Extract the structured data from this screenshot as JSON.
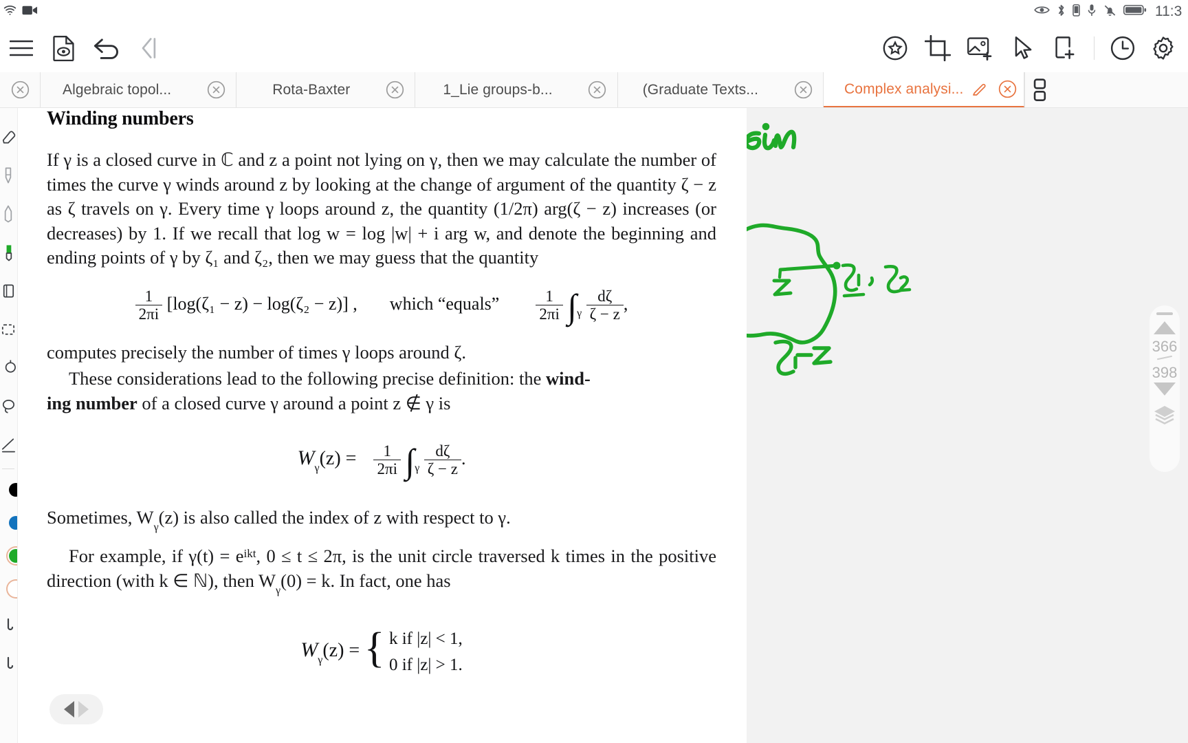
{
  "statusbar": {
    "left_icons": [
      "wifi-icon",
      "screen-record-icon"
    ],
    "right_icons": [
      "eye-icon",
      "bluetooth-icon",
      "battery-small-icon",
      "microphone-icon",
      "bell-off-icon",
      "battery-icon"
    ],
    "clock": "11:3"
  },
  "toolbar": {
    "left": [
      {
        "name": "menu-icon",
        "label": "Menu"
      },
      {
        "name": "document-preview-icon",
        "label": "Document preview"
      },
      {
        "name": "undo-icon",
        "label": "Undo"
      },
      {
        "name": "collapse-left-icon",
        "label": "Collapse panel"
      }
    ],
    "right": [
      {
        "name": "star-circle-icon",
        "label": "Favorite"
      },
      {
        "name": "crop-icon",
        "label": "Crop"
      },
      {
        "name": "add-image-icon",
        "label": "Insert image"
      },
      {
        "name": "cursor-select-icon",
        "label": "Select"
      },
      {
        "name": "add-page-icon",
        "label": "Add page"
      },
      {
        "name": "history-clock-icon",
        "label": "History"
      },
      {
        "name": "settings-gear-icon",
        "label": "Settings"
      }
    ]
  },
  "tabs": {
    "items": [
      {
        "label": "",
        "active": false,
        "stub": true
      },
      {
        "label": "Algebraic topol...",
        "active": false,
        "stub": false
      },
      {
        "label": "Rota-Baxter",
        "active": false,
        "stub": false
      },
      {
        "label": "1_Lie groups-b...",
        "active": false,
        "stub": false
      },
      {
        "label": "(Graduate Texts...",
        "active": false,
        "stub": false
      },
      {
        "label": "Complex analysi...",
        "active": true,
        "stub": false
      }
    ],
    "active_color": "#e8733f",
    "overview_icon": "tab-overview-icon"
  },
  "rail": {
    "tools": [
      {
        "name": "eraser-tool-icon"
      },
      {
        "name": "pen-tool-icon"
      },
      {
        "name": "pencil-tool-icon"
      },
      {
        "name": "highlighter-tool-icon"
      },
      {
        "name": "note-tool-icon"
      },
      {
        "name": "text-box-tool-icon"
      },
      {
        "name": "shape-tool-icon"
      },
      {
        "name": "lasso-tool-icon"
      },
      {
        "name": "ruler-tool-icon"
      }
    ],
    "swatches": [
      {
        "name": "color-swatch-black",
        "color": "#000000",
        "selected": false
      },
      {
        "name": "color-swatch-blue",
        "color": "#1273bd",
        "selected": false
      },
      {
        "name": "color-swatch-green",
        "color": "#1faa29",
        "selected": true
      },
      {
        "name": "color-swatch-outline",
        "color": "#ffffff",
        "selected": true
      }
    ]
  },
  "document": {
    "heading": "Winding numbers",
    "paragraphs": [
      {
        "indent": false,
        "text": "If γ is a closed curve in ℂ and z a point not lying on γ, then we may calculate the number of times the curve γ winds around z by looking at the change of argument of the quantity ζ − z as ζ travels on γ. Every time γ loops around z, the quantity (1/2π) arg(ζ − z) increases (or decreases) by 1. If we recall that log w = log |w| + i arg w, and denote the beginning and ending points of γ by ζ₁ and ζ₂, then we may guess that the quantity"
      }
    ],
    "equation1": {
      "frac1_num": "1",
      "frac1_den": "2πi",
      "bracket_expr": "[log(ζ₁ − z) − log(ζ₂ − z)] ,",
      "middle_text": "which “equals”",
      "frac2_num": "1",
      "frac2_den": "2πi",
      "integral": "∫",
      "integral_sub": "γ",
      "frac3_num": "dζ",
      "frac3_den": "ζ − z",
      "trailing": ","
    },
    "paragraph2": "computes precisely the number of times γ loops around ζ.",
    "paragraph3_pre": "These considerations lead to the following precise definition: the ",
    "paragraph3_bold1": "wind-",
    "paragraph3_bold2": "ing number",
    "paragraph3_post": " of a closed curve γ around a point z ∉ γ is",
    "equation2": {
      "lhs": "W",
      "lhs_sub": "γ",
      "lhs_arg": "(z) =",
      "frac_num": "1",
      "frac_den": "2πi",
      "integral": "∫",
      "integral_sub": "γ",
      "frac2_num": "dζ",
      "frac2_den": "ζ − z",
      "trailing": "."
    },
    "paragraph4": "Sometimes, W",
    "paragraph4_sub": "γ",
    "paragraph4_rest": "(z) is also called the index of z with respect to γ.",
    "paragraph5_pre": "For example, if γ(t) = e",
    "paragraph5_sup": "ikt",
    "paragraph5_post": ", 0 ≤ t ≤ 2π, is the unit circle traversed k times in the positive direction (with k ∈ ℕ), then W",
    "paragraph5_sub": "γ",
    "paragraph5_end": "(0) = k. In fact, one has",
    "equation3": {
      "lhs": "W",
      "lhs_sub": "γ",
      "lhs_arg": "(z) =",
      "case1": "k    if |z| < 1,",
      "case2": "0    if |z| > 1."
    }
  },
  "annotations": {
    "title_note": "Stein",
    "point_label": "z",
    "zeta_labels": "ζ₁ , ζ₂",
    "bottom_note": "ζ-z",
    "ink_color": "#1faa29"
  },
  "pagenav": {
    "current_page": "366",
    "total_pages": "398",
    "up_icon": "page-up-triangle-icon",
    "down_icon": "page-down-triangle-icon",
    "layers_icon": "layers-icon",
    "handle_icon": "drag-handle-icon"
  },
  "bottom_nav": {
    "prev_icon": "prev-arrow-icon",
    "next_icon": "next-arrow-icon"
  }
}
